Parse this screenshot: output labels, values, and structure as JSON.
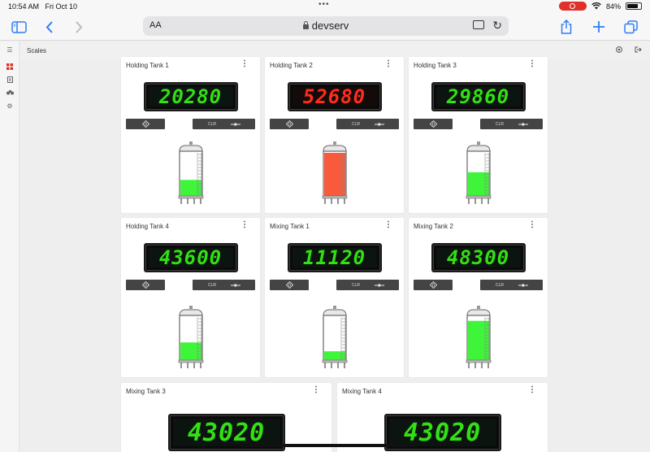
{
  "status": {
    "time": "10:54 AM",
    "date": "Fri Oct 10",
    "battery": "84%",
    "dots": "•••"
  },
  "browser": {
    "aa": "AA",
    "url": "devserv"
  },
  "app": {
    "title": "Scales"
  },
  "colors": {
    "green": "#33e014",
    "red": "#ff2d1a",
    "tank_green": "#3ff53a",
    "tank_red": "#f95a3c"
  },
  "cards": [
    {
      "name": "Holding Tank 1",
      "value": "20280",
      "display": "green",
      "fill": 0.36,
      "fill_color": "tank_green"
    },
    {
      "name": "Holding Tank 2",
      "value": "52680",
      "display": "red",
      "fill": 1.0,
      "fill_color": "tank_red"
    },
    {
      "name": "Holding Tank 3",
      "value": "29860",
      "display": "green",
      "fill": 0.54,
      "fill_color": "tank_green"
    },
    {
      "name": "Holding Tank 4",
      "value": "43600",
      "display": "green",
      "fill": 0.4,
      "fill_color": "tank_green"
    },
    {
      "name": "Mixing Tank 1",
      "value": "11120",
      "display": "green",
      "fill": 0.19,
      "fill_color": "tank_green"
    },
    {
      "name": "Mixing Tank 2",
      "value": "48300",
      "display": "green",
      "fill": 0.91,
      "fill_color": "tank_green"
    },
    {
      "name": "Mixing Tank 3",
      "value": "43020",
      "display": "green"
    },
    {
      "name": "Mixing Tank 4",
      "value": "43020",
      "display": "green"
    }
  ],
  "buttons": {
    "zero_icon": "zero-icon",
    "clr": "CLR",
    "tare_icon": "tare-icon"
  }
}
